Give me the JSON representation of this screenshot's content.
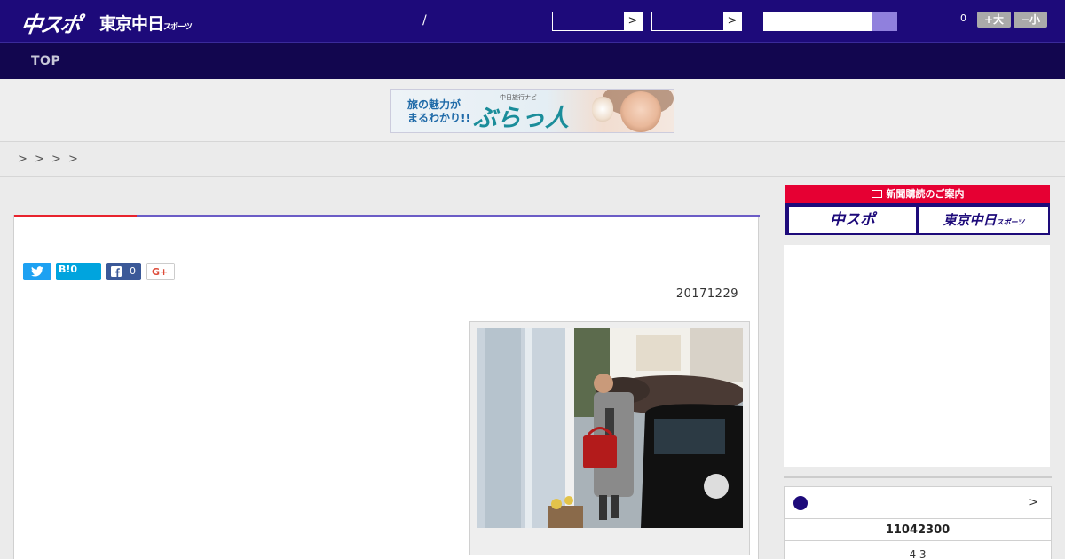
{
  "header": {
    "logo_chuspo": "中スポ",
    "logo_tokyo": "東京中日",
    "logo_tokyo_sub": "スポーツ",
    "separator": "/",
    "select_arrow": ">",
    "font_count": "0",
    "font_large": "+大",
    "font_small": "−小"
  },
  "nav": {
    "top_label": "TOP"
  },
  "ad": {
    "line1": "旅の魅力が",
    "line2": "まるわかり!!",
    "small": "中日旅行ナビ",
    "brand": "ぶらっ人"
  },
  "breadcrumb": {
    "items": [
      ">",
      ">",
      ">",
      ">"
    ]
  },
  "article": {
    "share_hatena": "B!0",
    "share_facebook_count": "0",
    "share_gplus": "G+",
    "date": "20171229"
  },
  "sidebar": {
    "subscribe_title": "新聞購読のご案内",
    "subscribe_chuspo": "中スポ",
    "subscribe_tokyo": "東京中日",
    "subscribe_tokyo_sub": "スポーツ",
    "score_more": ">",
    "score_date": "11042300",
    "score_line": "4  3"
  },
  "colors": {
    "header_bg": "#1d0a7a",
    "nav_bg": "#12064f",
    "accent_red": "#e8232d",
    "accent_purple": "#6b5cc6"
  }
}
